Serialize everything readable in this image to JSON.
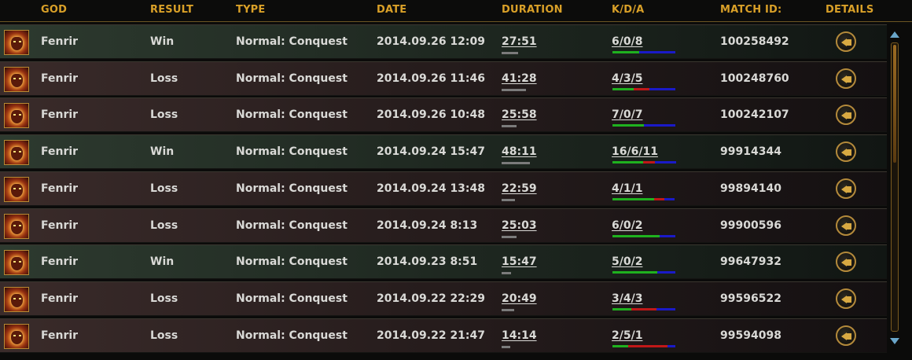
{
  "header": {
    "god": "GOD",
    "result": "RESULT",
    "type": "TYPE",
    "date": "DATE",
    "duration": "DURATION",
    "kda": "K/D/A",
    "match_id": "MATCH ID:",
    "details": "DETAILS"
  },
  "colors": {
    "accent": "#d9a028",
    "kill": "#1fb11f",
    "death": "#c01818",
    "assist": "#1a1ac8",
    "win_row": "#2d3a2f",
    "loss_row": "#3a2b2a"
  },
  "matches": [
    {
      "god": "Fenrir",
      "result": "Win",
      "type": "Normal: Conquest",
      "date": "2014.09.26 12:09",
      "duration": "27:51",
      "kda": "6/0/8",
      "match_id": "100258492"
    },
    {
      "god": "Fenrir",
      "result": "Loss",
      "type": "Normal: Conquest",
      "date": "2014.09.26 11:46",
      "duration": "41:28",
      "kda": "4/3/5",
      "match_id": "100248760"
    },
    {
      "god": "Fenrir",
      "result": "Loss",
      "type": "Normal: Conquest",
      "date": "2014.09.26 10:48",
      "duration": "25:58",
      "kda": "7/0/7",
      "match_id": "100242107"
    },
    {
      "god": "Fenrir",
      "result": "Win",
      "type": "Normal: Conquest",
      "date": "2014.09.24 15:47",
      "duration": "48:11",
      "kda": "16/6/11",
      "match_id": "99914344"
    },
    {
      "god": "Fenrir",
      "result": "Loss",
      "type": "Normal: Conquest",
      "date": "2014.09.24 13:48",
      "duration": "22:59",
      "kda": "4/1/1",
      "match_id": "99894140"
    },
    {
      "god": "Fenrir",
      "result": "Loss",
      "type": "Normal: Conquest",
      "date": "2014.09.24  8:13",
      "duration": "25:03",
      "kda": "6/0/2",
      "match_id": "99900596"
    },
    {
      "god": "Fenrir",
      "result": "Win",
      "type": "Normal: Conquest",
      "date": "2014.09.23  8:51",
      "duration": "15:47",
      "kda": "5/0/2",
      "match_id": "99647932"
    },
    {
      "god": "Fenrir",
      "result": "Loss",
      "type": "Normal: Conquest",
      "date": "2014.09.22 22:29",
      "duration": "20:49",
      "kda": "3/4/3",
      "match_id": "99596522"
    },
    {
      "god": "Fenrir",
      "result": "Loss",
      "type": "Normal: Conquest",
      "date": "2014.09.22 21:47",
      "duration": "14:14",
      "kda": "2/5/1",
      "match_id": "99594098"
    }
  ]
}
